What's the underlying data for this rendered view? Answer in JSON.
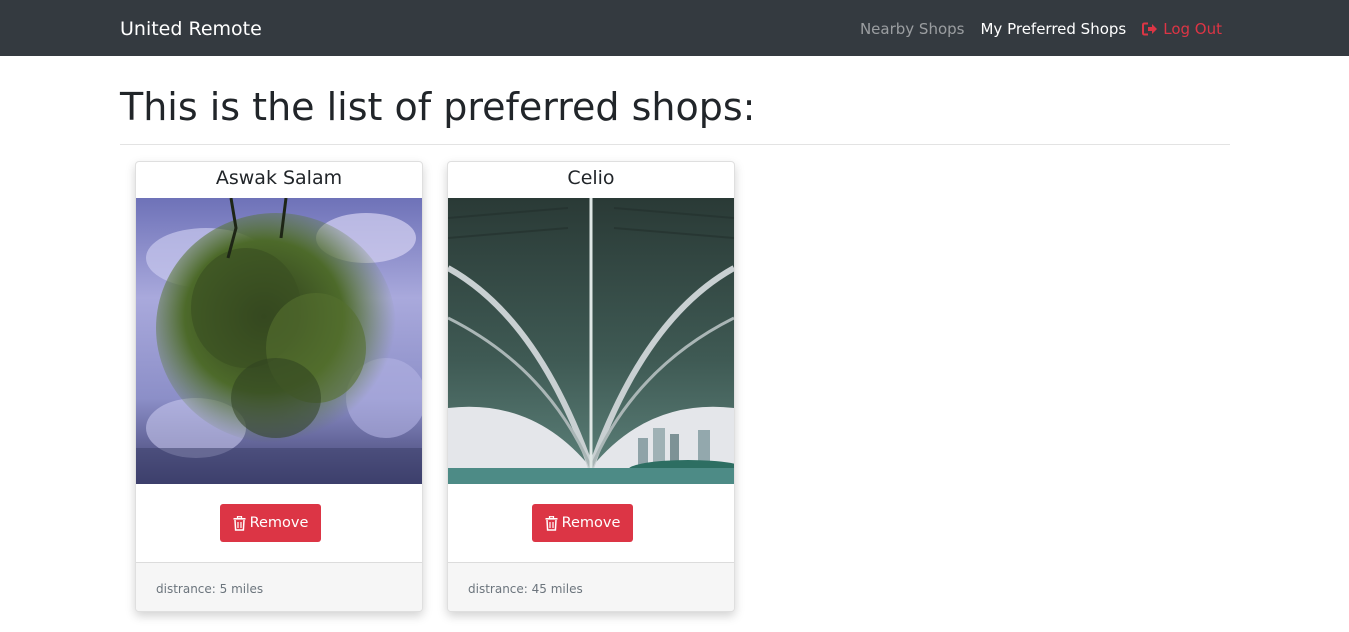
{
  "navbar": {
    "brand": "United Remote",
    "links": [
      "Nearby Shops",
      "My Preferred Shops",
      "Log Out"
    ]
  },
  "main": {
    "title": "This is the list of preferred shops:"
  },
  "shops": [
    {
      "name": "Aswak Salam",
      "button_label": "Remove",
      "distance_text": "distrance: 5 miles"
    },
    {
      "name": "Celio",
      "button_label": "Remove",
      "distance_text": "distrance: 45 miles"
    }
  ],
  "icons": {
    "logout": "sign-out-icon",
    "remove": "trash-icon"
  },
  "colors": {
    "navbar_bg": "#343a40",
    "danger": "#dc3545",
    "muted_link": "rgba(255,255,255,0.5)"
  }
}
